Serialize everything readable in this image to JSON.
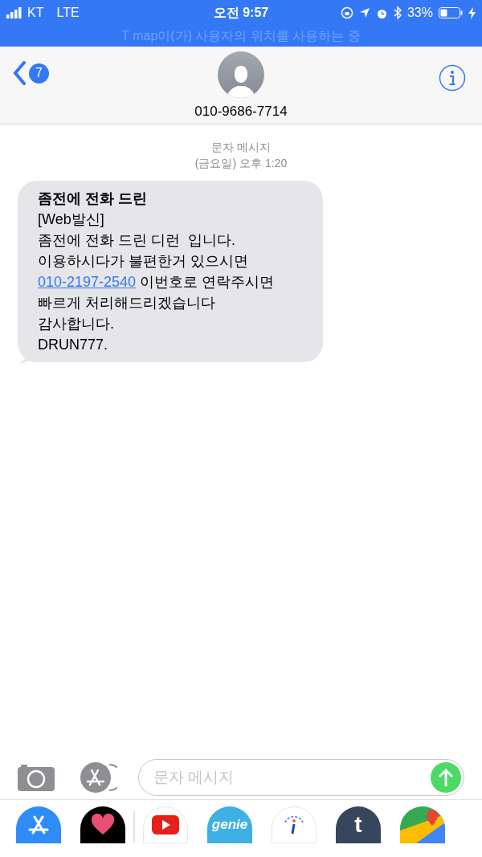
{
  "status_bar": {
    "carrier": "KT",
    "network": "LTE",
    "time": "오전 9:57",
    "battery": "33%",
    "banner": "T map이(가) 사용자의 위치를 사용하는 중"
  },
  "header": {
    "back_count": "7",
    "contact": "010-9686-7714"
  },
  "thread": {
    "service": "문자 메시지",
    "timestamp": "(금요일) 오후 1:20"
  },
  "message": {
    "title": "좀전에 전화 드린",
    "lines": [
      {
        "text": "[Web발신]"
      },
      {
        "text": "좀전에 전화 드린 디런  입니다."
      },
      {
        "text": "이용하시다가 불편한거 있으시면"
      },
      {
        "link": "010-2197-2540",
        "text": " 이번호로 연락주시면"
      },
      {
        "text": "빠르게 처리해드리겠습니다"
      },
      {
        "text": "감사합니다."
      },
      {
        "text": "DRUN777."
      }
    ]
  },
  "composer": {
    "placeholder": "문자 메시지"
  },
  "app_drawer": [
    {
      "kind": "appstore"
    },
    {
      "kind": "heart"
    },
    {
      "kind": "youtube"
    },
    {
      "kind": "genie",
      "label": "genie"
    },
    {
      "kind": "wi"
    },
    {
      "kind": "tumblr",
      "label": "t"
    },
    {
      "kind": "maps"
    }
  ]
}
